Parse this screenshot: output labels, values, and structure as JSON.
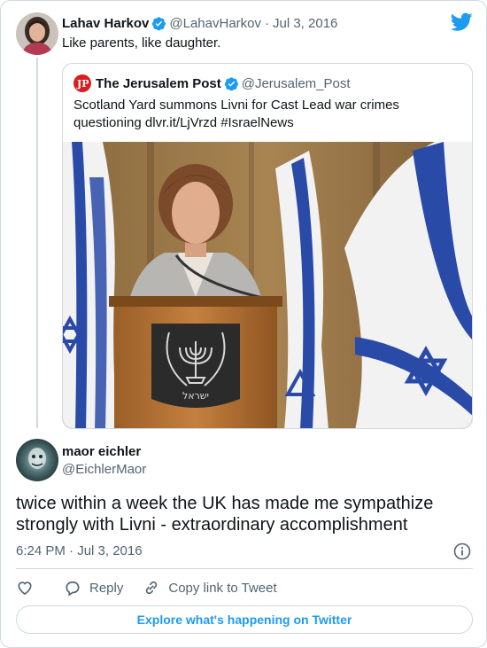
{
  "parent_tweet": {
    "display_name": "Lahav Harkov",
    "handle": "@LahavHarkov",
    "separator": "·",
    "date": "Jul 3, 2016",
    "text": "Like parents, like daughter."
  },
  "quoted_tweet": {
    "display_name": "The Jerusalem Post",
    "handle": "@Jerusalem_Post",
    "text": "Scotland Yard summons Livni for Cast Lead war crimes questioning dlvr.it/LjVrzd #IsraelNews",
    "image_podium_text": "ישראל"
  },
  "main_tweet": {
    "display_name": "maor eichler",
    "handle": "@EichlerMaor",
    "text": "twice within a week the UK has made me sympathize strongly with Livni - extraordinary accomplishment",
    "timestamp": "6:24 PM · Jul 3, 2016"
  },
  "actions": {
    "reply_label": "Reply",
    "copy_link_label": "Copy link to Tweet"
  },
  "explore_label": "Explore what's happening on Twitter",
  "colors": {
    "twitter_blue": "#1d9bf0",
    "text_primary": "#0f1419",
    "text_secondary": "#536471",
    "border": "#cfd9de",
    "jpost_red": "#d81e1e"
  },
  "icons": {
    "twitter_logo": "twitter-bird-icon",
    "verified": "verified-badge-icon",
    "info": "info-icon",
    "like": "heart-icon",
    "reply": "reply-bubble-icon",
    "copy_link": "link-icon"
  }
}
